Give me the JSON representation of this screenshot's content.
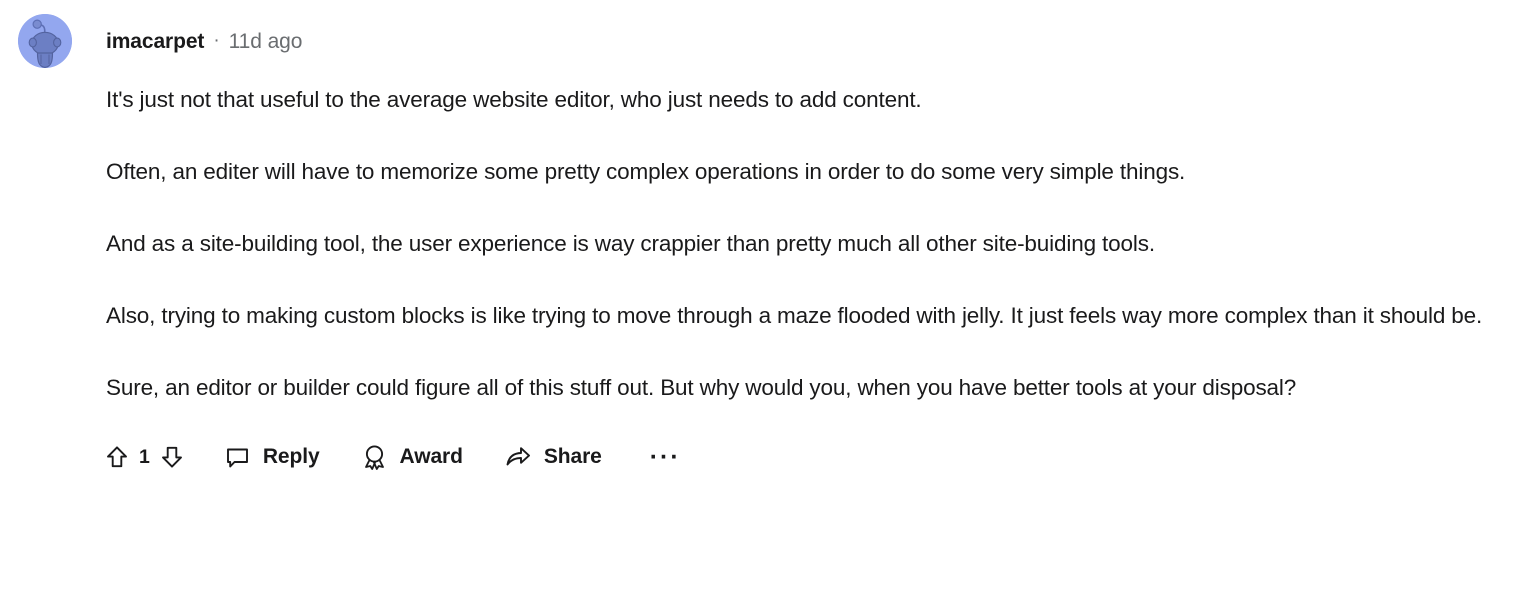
{
  "comment": {
    "author": "imacarpet",
    "separator": "·",
    "timestamp": "11d ago",
    "avatar_alt": "snoo-avatar",
    "paragraphs": [
      "It's just not that useful to the average website editor, who just needs to add content.",
      "Often, an editer will have to memorize some pretty complex operations in order to do some very simple things.",
      "And as a site-building tool, the user experience is way crappier than pretty much all other site-buiding tools.",
      "Also, trying to making custom blocks is like trying to move through a maze flooded with jelly. It just feels way more complex than it should be.",
      "Sure, an editor or builder could figure all of this stuff out. But why would you, when you have better tools at your disposal?"
    ]
  },
  "actions": {
    "upvote_icon": "upvote-arrow-icon",
    "vote_count": "1",
    "downvote_icon": "downvote-arrow-icon",
    "reply_label": "Reply",
    "reply_icon": "comment-bubble-icon",
    "award_label": "Award",
    "award_icon": "award-ribbon-icon",
    "share_label": "Share",
    "share_icon": "share-arrow-icon",
    "more_label": "···"
  },
  "colors": {
    "text": "#1a1a1b",
    "muted": "#6a6d70",
    "avatar_bg": "#93a7ef",
    "avatar_body": "#6c7fc4",
    "page_bg": "#ffffff"
  }
}
